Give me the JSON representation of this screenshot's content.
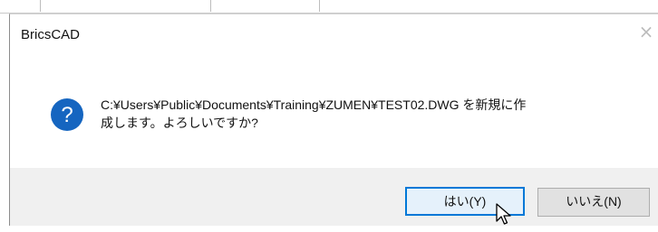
{
  "window": {
    "title": "BricsCAD",
    "close_glyph": "×"
  },
  "dialog": {
    "icon": "question-icon",
    "icon_glyph": "?",
    "message_line1": "C:¥Users¥Public¥Documents¥Training¥ZUMEN¥TEST02.DWG を新規に作",
    "message_line2": "成します。よろしいですか?"
  },
  "buttons": {
    "yes_label": "はい(Y)",
    "no_label": "いいえ(N)"
  },
  "colors": {
    "accent": "#0078d7",
    "icon_fill": "#1565c0",
    "footer_bg": "#f0f0f0"
  }
}
